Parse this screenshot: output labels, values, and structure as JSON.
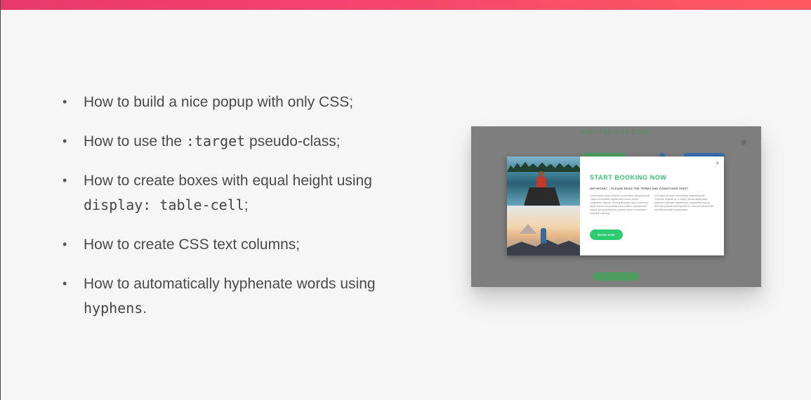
{
  "bullets": [
    {
      "text_before": "How to build a nice popup with only CSS;",
      "code": "",
      "text_after": ""
    },
    {
      "text_before": "How to use the ",
      "code": ":target",
      "text_after": " pseudo-class;"
    },
    {
      "text_before": "How to create boxes with equal height using ",
      "code": "display: table-cell",
      "text_after": ";"
    },
    {
      "text_before": "How to create CSS text columns;",
      "code": "",
      "text_after": ""
    },
    {
      "text_before": "How to automatically hyphenate words using ",
      "code": "hyphens",
      "text_after": "."
    }
  ],
  "bullet_symbol": "•",
  "preview": {
    "background_title": "MOST POPULAR TOURS",
    "popup": {
      "heading": "START BOOKING NOW",
      "subheading": "IMPORTANT – PLEASE READ THE TERMS AND CONDITIONS FIRST",
      "column_1": "Lorem ipsum dolor sit amet, consectetur adipisicing elit. Totam consectetur repellendus conse-quatur, voluptatem suscipit. Dicta quibusdam quos, commodi, ipsum earum recusandae exerci-tation, repudiandae magni, qui-amenita error placeat, earum consectetur expedita! Laborup-",
      "column_2": "sum dolor sit amet, consectetur adipisicing elit. Corporis, impedit, id. A magni, omnia aspernatur! Nostrum imperdiet repellendus, consectetur ami-mi. Sint nisi, placeat sed Expedita ex, dicerum perferendis repellat blanditiis repudiandae!",
      "close_symbol": "×",
      "button_label": "BOOK NOW"
    }
  },
  "colors": {
    "top_bar_start": "#e8386a",
    "top_bar_end": "#ff5a60",
    "accent_green": "#2ecc71",
    "text": "#4a4a4a"
  }
}
